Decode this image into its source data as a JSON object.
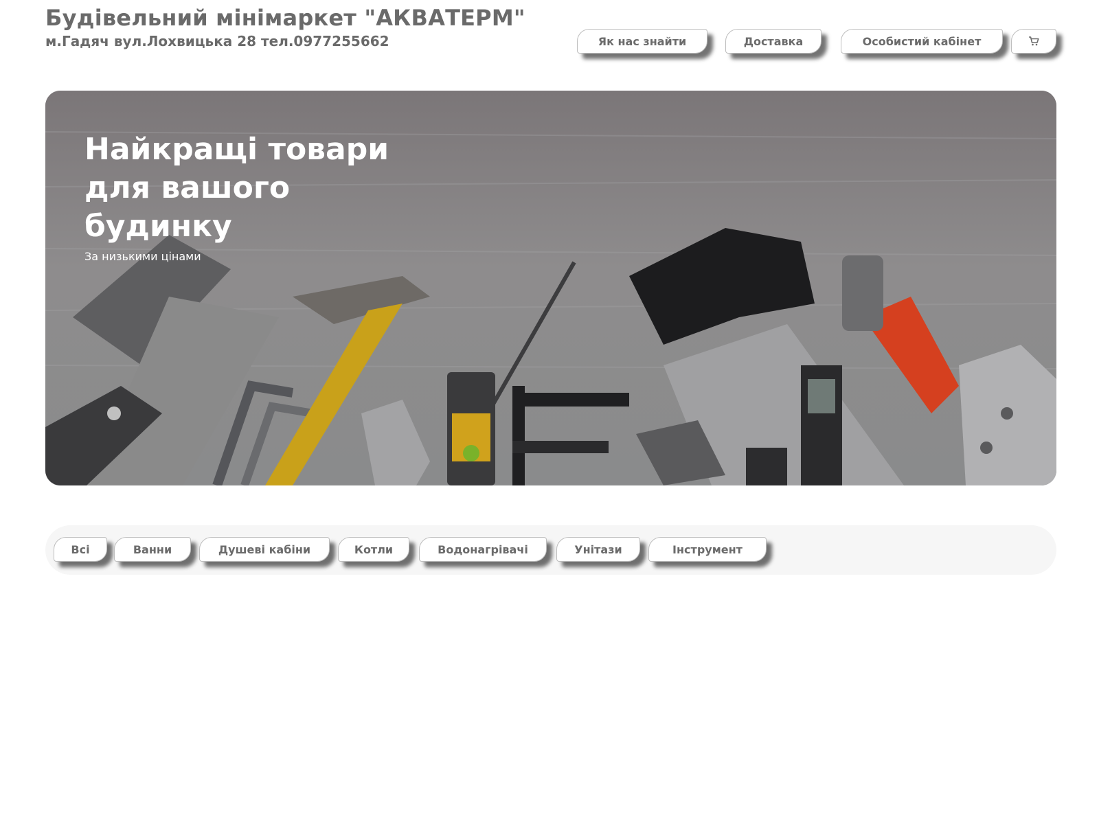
{
  "header": {
    "title": "Будівельний мінімаркет \"АКВАТЕРМ\"",
    "address": "м.Гадяч вул.Лохвицька 28 тел.0977255662"
  },
  "nav": {
    "find_us": "Як нас знайти",
    "delivery": "Доставка",
    "account": "Особистий кабінет",
    "cart_icon": "cart-icon"
  },
  "hero": {
    "title": "Найкращі товари для вашого будинку",
    "subtitle": "За низькими цінами"
  },
  "categories": {
    "all": "Всі",
    "baths": "Ванни",
    "showers": "Душеві кабіни",
    "boilers": "Котли",
    "heaters": "Водонагрівачі",
    "toilets": "Унітази",
    "tools": "Інструмент"
  }
}
